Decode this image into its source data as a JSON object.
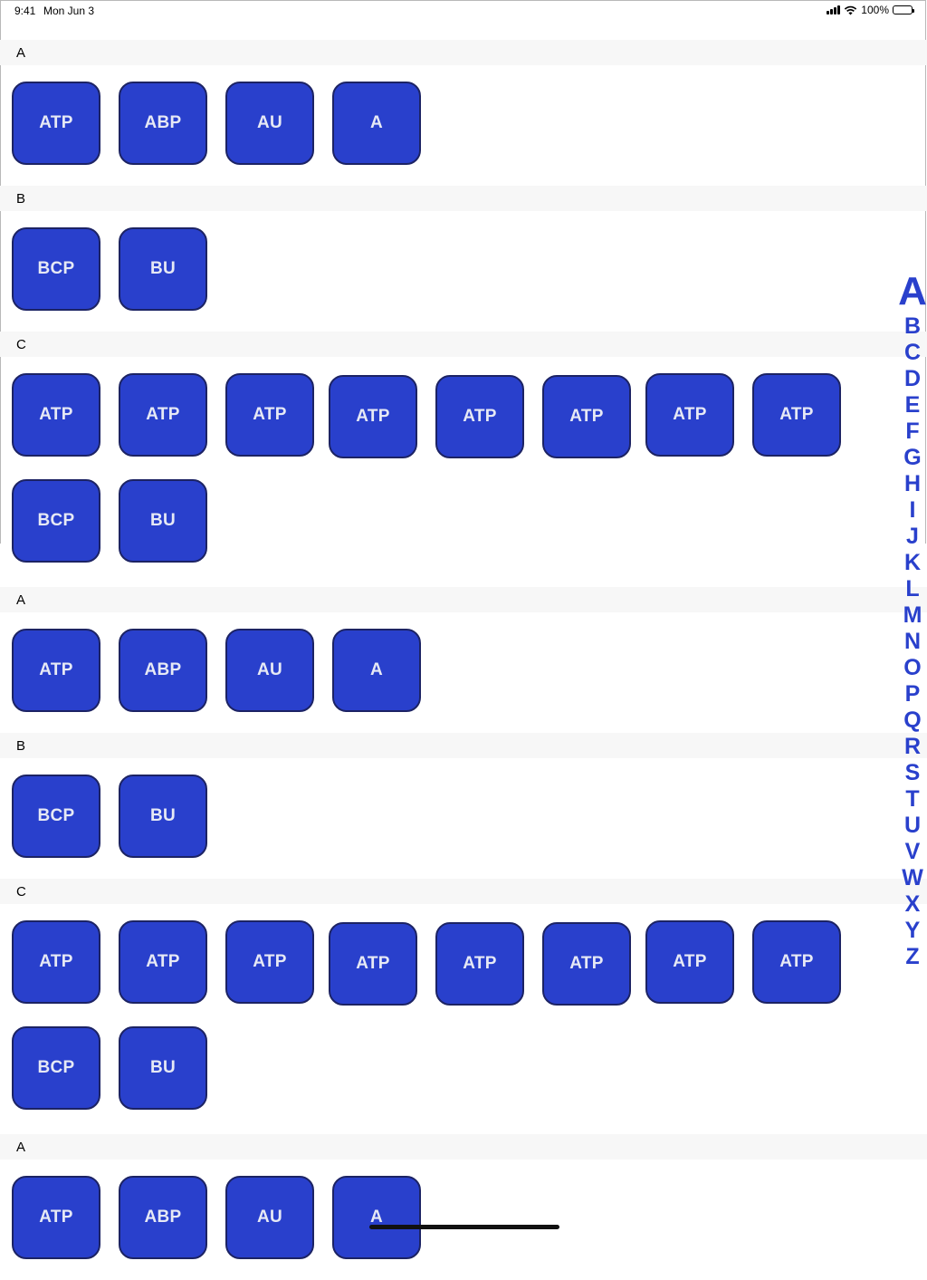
{
  "status_bar": {
    "time": "9:41",
    "date": "Mon Jun 3",
    "battery": "100%"
  },
  "sections": [
    {
      "title": "A",
      "rows": [
        [
          "ATP",
          "ABP",
          "AU",
          "A"
        ]
      ]
    },
    {
      "title": "B",
      "rows": [
        [
          "BCP",
          "BU"
        ]
      ]
    },
    {
      "title": "C",
      "rows": [
        [
          "ATP",
          "ATP",
          "ATP",
          "ATP",
          "ATP",
          "ATP",
          "ATP",
          "ATP"
        ],
        [
          "BCP",
          "BU"
        ]
      ]
    },
    {
      "title": "A",
      "rows": [
        [
          "ATP",
          "ABP",
          "AU",
          "A"
        ]
      ]
    },
    {
      "title": "B",
      "rows": [
        [
          "BCP",
          "BU"
        ]
      ]
    },
    {
      "title": "C",
      "rows": [
        [
          "ATP",
          "ATP",
          "ATP",
          "ATP",
          "ATP",
          "ATP",
          "ATP",
          "ATP"
        ],
        [
          "BCP",
          "BU"
        ]
      ]
    },
    {
      "title": "A",
      "rows": [
        [
          "ATP",
          "ABP",
          "AU",
          "A"
        ]
      ]
    }
  ],
  "section_index": [
    "A",
    "B",
    "C",
    "D",
    "E",
    "F",
    "G",
    "H",
    "I",
    "J",
    "K",
    "L",
    "M",
    "N",
    "O",
    "P",
    "Q",
    "R",
    "S",
    "T",
    "U",
    "V",
    "W",
    "X",
    "Y",
    "Z"
  ],
  "section_index_active": "A",
  "colors": {
    "tile_fill": "#2940cc",
    "tile_border": "#1c2364",
    "tile_text": "#e6e9f5",
    "index_text": "#2940cc",
    "header_background": "#f7f7f7"
  }
}
